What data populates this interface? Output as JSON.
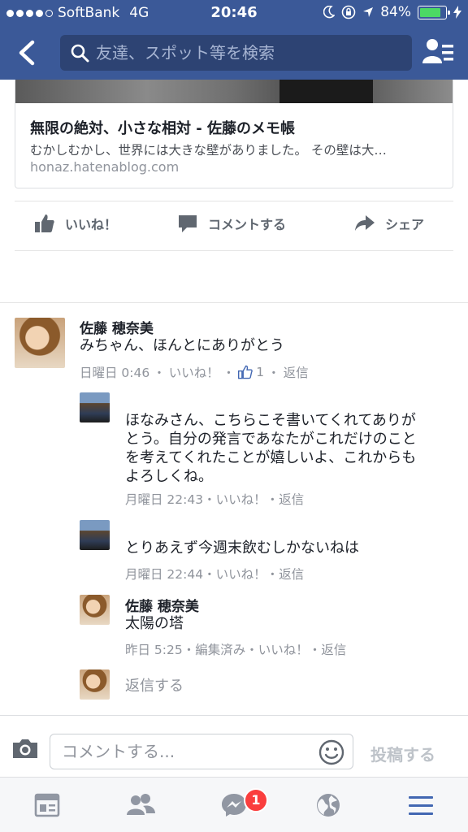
{
  "status_bar": {
    "carrier": "SoftBank",
    "network": "4G",
    "time": "20:46",
    "battery": "84%",
    "battery_level": 0.84
  },
  "search": {
    "placeholder": "友達、スポット等を検索"
  },
  "link_preview": {
    "title": "無限の絶対、小さな相対 - 佐藤のメモ帳",
    "description": "むかしむかし、世界には大きな壁がありました。 その壁は大…",
    "domain": "honaz.hatenablog.com"
  },
  "actions": {
    "like": "いいね！",
    "comment": "コメントする",
    "share": "シェア"
  },
  "comments": [
    {
      "name": "佐藤 穂奈美",
      "text": [
        "みちゃん、ほんとにありがとう"
      ],
      "meta_time": "日曜日 0:46",
      "meta_like": "いいね！",
      "like_count": "1",
      "meta_reply": "返信"
    }
  ],
  "replies": [
    {
      "text": [
        "ほなみさん、こちらこそ書いてくれてありが",
        "とう。自分の発言であなたがこれだけのこと",
        "を考えてくれたことが嬉しいよ、これからも",
        "よろしくね。"
      ],
      "meta": "月曜日 22:43・いいね！・返信"
    },
    {
      "text": [
        "とりあえず今週末飲むしかないねは"
      ],
      "meta": "月曜日 22:44・いいね！・返信"
    },
    {
      "name": "佐藤 穂奈美",
      "text": [
        "太陽の塔"
      ],
      "meta": "昨日 5:25・編集済み・いいね！・返信"
    }
  ],
  "reply_prompt": "返信する",
  "composer": {
    "placeholder": "コメントする...",
    "post_label": "投稿する"
  },
  "tab_bar": {
    "messenger_badge": "1"
  },
  "colors": {
    "header": "#3b5998",
    "secondary_text": "#90949c",
    "badge": "#fa3e3e"
  }
}
